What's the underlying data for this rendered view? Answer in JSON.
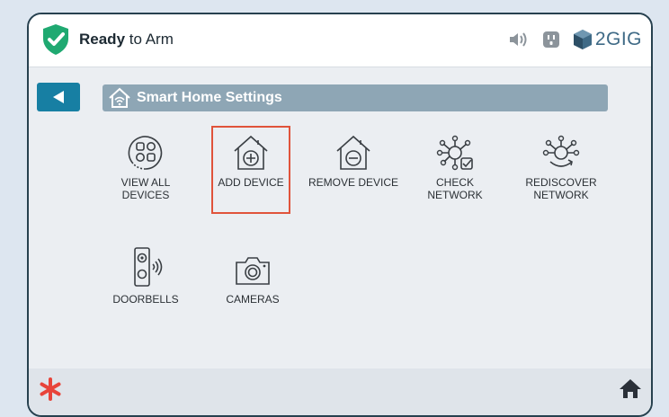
{
  "status": {
    "strong": "Ready",
    "rest": " to Arm"
  },
  "brand": {
    "name": "2GIG"
  },
  "icons": {
    "status": "shield-check-icon",
    "night": "moon-icon",
    "volume": "speaker-icon",
    "outlet": "power-outlet-icon",
    "brand_logo": "2gig-cube-icon",
    "back": "triangle-left-icon",
    "title": "wifi-house-icon",
    "emergency": "asterisk-icon",
    "home": "home-icon"
  },
  "header": {
    "title": "Smart Home Settings"
  },
  "tiles": [
    {
      "line1": "VIEW ALL",
      "line2": "DEVICES"
    },
    {
      "line1": "ADD DEVICE",
      "line2": ""
    },
    {
      "line1": "REMOVE DEVICE",
      "line2": ""
    },
    {
      "line1": "CHECK",
      "line2": "NETWORK"
    },
    {
      "line1": "REDISCOVER",
      "line2": "NETWORK"
    },
    {
      "line1": "DOORBELLS",
      "line2": ""
    },
    {
      "line1": "CAMERAS",
      "line2": ""
    }
  ],
  "colors": {
    "accent": "#177fa3",
    "status_ok": "#1fa971",
    "title_bar": "#8ea6b5",
    "selection": "#e0533b",
    "emergency": "#e8443a"
  }
}
